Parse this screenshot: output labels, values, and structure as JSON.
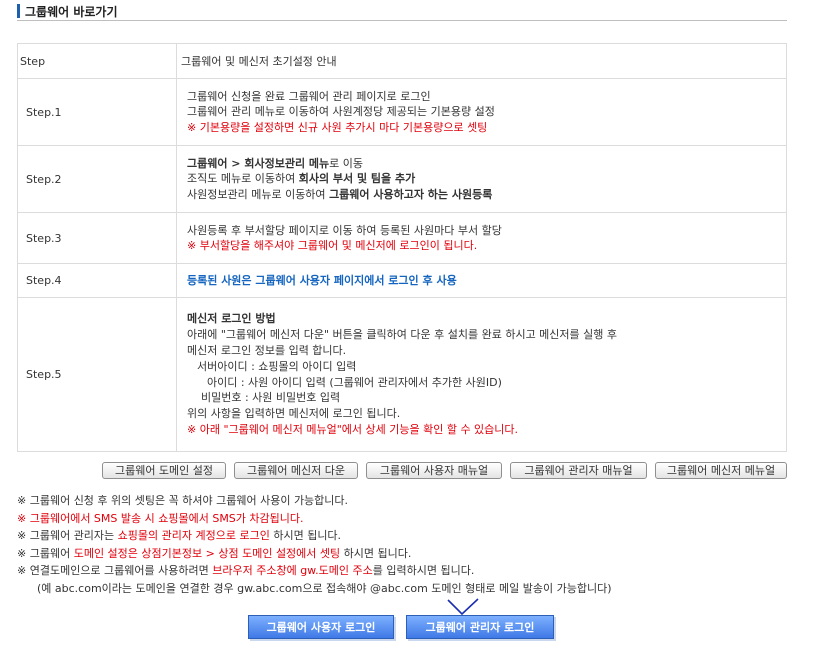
{
  "section_title": "그룹웨어 바로가기",
  "table": {
    "header": {
      "step": "Step",
      "desc": "그룹웨어 및 메신저 초기설정 안내"
    },
    "rows": [
      {
        "step": "Step.1",
        "lines": [
          "그룹웨어 신청을 완료 그룹웨어 관리 페이지로 로그인",
          "그룹웨어 관리 메뉴로 이동하여 사원계정당 제공되는 기본용량 설정",
          "※ 기본용량을 설정하면 신규 사원 추가시 마다 기본용량으로 셋팅"
        ]
      },
      {
        "step": "Step.2",
        "line1": {
          "bold": "그룹웨어 > 회사정보관리 메뉴",
          "rest": "로 이동"
        },
        "line2": {
          "pre": "조직도 메뉴로 이동하여 ",
          "bold": "회사의 부서 및 팀을 추가"
        },
        "line3": {
          "pre": "사원정보관리 메뉴로 이동하여 ",
          "bold": "그룹웨어 사용하고자 하는 사원등록"
        }
      },
      {
        "step": "Step.3",
        "lines": [
          "사원등록 후 부서할당 페이지로 이동 하여 등록된 사원마다 부서 할당",
          "※ 부서할당을 해주셔야 그룹웨어 및 메신저에 로그인이 됩니다."
        ]
      },
      {
        "step": "Step.4",
        "lines": [
          "등록된 사원은 그룹웨어 사용자 페이지에서 로그인 후 사용"
        ]
      },
      {
        "step": "Step.5",
        "lines": [
          "메신저 로그인 방법",
          "아래에 \"그룹웨어 메신저 다운\" 버튼을 클릭하여 다운 후 설치를 완료 하시고 메신저를 실행 후",
          "메신저 로그인 정보를 입력 합니다.",
          "서버아이디 : 쇼핑몰의 아이디 입력",
          "아이디 : 사원 아이디 입력 (그룹웨어 관리자에서 추가한 사원ID)",
          "비밀번호 : 사원 비밀번호 입력",
          "위의 사항을 입력하면 메신저에 로그인 됩니다.",
          "※ 아래 \"그룹웨어 메신저 메뉴얼\"에서 상세 기능을 확인 할 수 있습니다."
        ]
      }
    ]
  },
  "buttons": [
    "그룹웨어 도메인 설정",
    "그룹웨어 메신저 다운",
    "그룹웨어 사용자 매뉴얼",
    "그룹웨어 관리자 매뉴얼",
    "그룹웨어 메신저 메뉴얼"
  ],
  "notes": {
    "n1": "※ 그룹웨어 신청 후 위의 셋팅은 꼭 하셔야 그룹웨어 사용이 가능합니다.",
    "n2": "※ 그룹웨어에서 SMS 발송 시 쇼핑몰에서 SMS가 차감됩니다.",
    "n3": {
      "a": "※ 그룹웨어 관리자는 ",
      "b": "쇼핑몰의 관리자 계정으로 로그인",
      "c": " 하시면 됩니다."
    },
    "n4": {
      "a": "※ 그룹웨어 ",
      "b": "도메인 설정은 상점기본정보 > 상점 도메인 설정에서 셋팅",
      "c": " 하시면 됩니다."
    },
    "n5": {
      "a": "※ 연결도메인으로 그룹웨어를 사용하려면 ",
      "b": "브라우저 주소창에 gw.도메인 주소",
      "c": "를 입력하시면 됩니다."
    },
    "n6": "(예 abc.com이라는 도메인을 연결한 경우 gw.abc.com으로 접속해야 @abc.com 도메인 형태로 메일 발송이 가능합니다)"
  },
  "login": {
    "user": "그룹웨어 사용자 로그인",
    "admin": "그룹웨어 관리자 로그인"
  },
  "colors": {
    "accent": "#1f5fb0",
    "red": "#e0000b",
    "blue": "#1565c0",
    "button_blue": "#4f88f0"
  }
}
